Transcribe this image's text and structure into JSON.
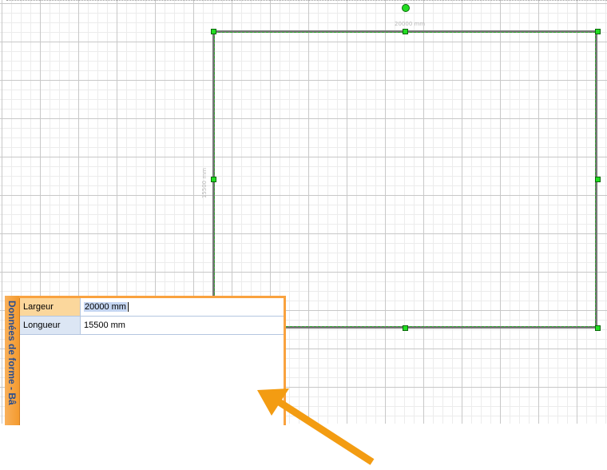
{
  "shape_data_window": {
    "title": "Données de forme - Bâ",
    "rows": [
      {
        "name": "Largeur",
        "value": "20000 mm",
        "editing": true
      },
      {
        "name": "Longueur",
        "value": "15500 mm",
        "editing": false
      }
    ]
  },
  "shape": {
    "top_dimension_label": "20000 mm",
    "left_dimension_label": "15500 mm"
  },
  "colors": {
    "selection_handle": "#22dd22",
    "shape_border": "#777777",
    "panel_frame": "#f9a23f",
    "arrow": "#f39c12"
  },
  "icons": [
    "rotation-handle-icon",
    "resize-handle-icon",
    "annotation-arrow-icon"
  ]
}
